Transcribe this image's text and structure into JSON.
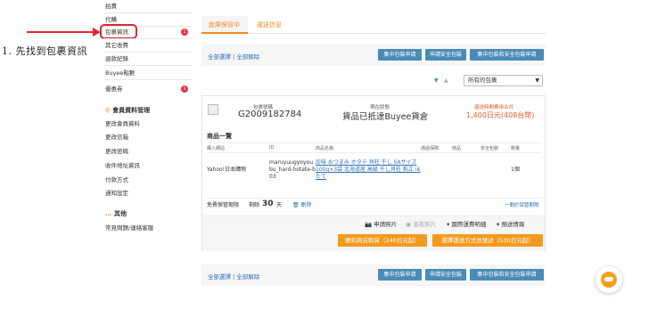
{
  "annotation": "1. 先找到包裹資訊",
  "sidebar": {
    "items": [
      {
        "label": "拍賣"
      },
      {
        "label": "代購"
      },
      {
        "label": "包裹資訊",
        "badge": "1"
      },
      {
        "label": "其它收費"
      },
      {
        "label": "退款紀錄"
      },
      {
        "label": "Buyee點數"
      },
      {
        "label": "優惠券",
        "badge": "1"
      }
    ],
    "member_section": {
      "title": "會員資料管理",
      "items": [
        {
          "label": "更改會員資料"
        },
        {
          "label": "更改信箱"
        },
        {
          "label": "更改密碼"
        },
        {
          "label": "收件地址資訊"
        },
        {
          "label": "付款方式"
        },
        {
          "label": "通知設定"
        }
      ]
    },
    "other_section": {
      "title": "其他",
      "items": [
        {
          "label": "常見問題/連絡客服"
        }
      ]
    }
  },
  "tabs": [
    {
      "label": "倉庫保管中",
      "active": true
    },
    {
      "label": "運送信息",
      "active": false
    }
  ],
  "toolbar": {
    "select_all": "全部選擇",
    "deselect_all": "全部解除",
    "buttons": [
      "集中包裝申請",
      "申請安全包裝",
      "集中包裝和安全包裝申請"
    ]
  },
  "filter": {
    "sort_down": "▼",
    "sort_up": "▲",
    "selected": "所有的包裹"
  },
  "package": {
    "number_label": "包裹號碼",
    "number": "G2009182784",
    "status_label": "現在狀態",
    "status": "貨品已抵達Buyee貨倉",
    "fee_label": "還送時間費用合共",
    "fee": "1,400日元(408台幣)",
    "products_title": "商品一覽",
    "columns": [
      "購入網站",
      "ID",
      "商品名稱",
      "通過保障",
      "榜品",
      "安全包裝",
      "數量"
    ],
    "rows": [
      {
        "site": "Yahoo!日本購物",
        "id": "maruyuugyoyoubu_hard-hotate-b03",
        "name": "珍味 おつまみ ホタテ 貝柱 干し SAサイズ 100g×3袋 北海道産 高級 干し貝柱 帆立 ほたて",
        "qty": "1個"
      }
    ],
    "free_storage_label": "免費保管期限",
    "remaining_label": "剩餘",
    "remaining_days": "30",
    "days_unit": "天",
    "delete_label": "刪除",
    "period_link": "一關於保管期限"
  },
  "actions": {
    "request_photo": "申請照片",
    "view_photo": "查看照片",
    "intl_detail": "國際運費明細",
    "estimate": "預送情報",
    "btn_convenience": "便利商店取貨（240日元起）",
    "btn_shipping": "選擇運送方式並發送（530日元起）"
  },
  "colors": {
    "accent": "#f38a1e",
    "button_blue": "#4a8bb8",
    "highlight_red": "#e0262b",
    "link_blue": "#2c6fb7"
  }
}
